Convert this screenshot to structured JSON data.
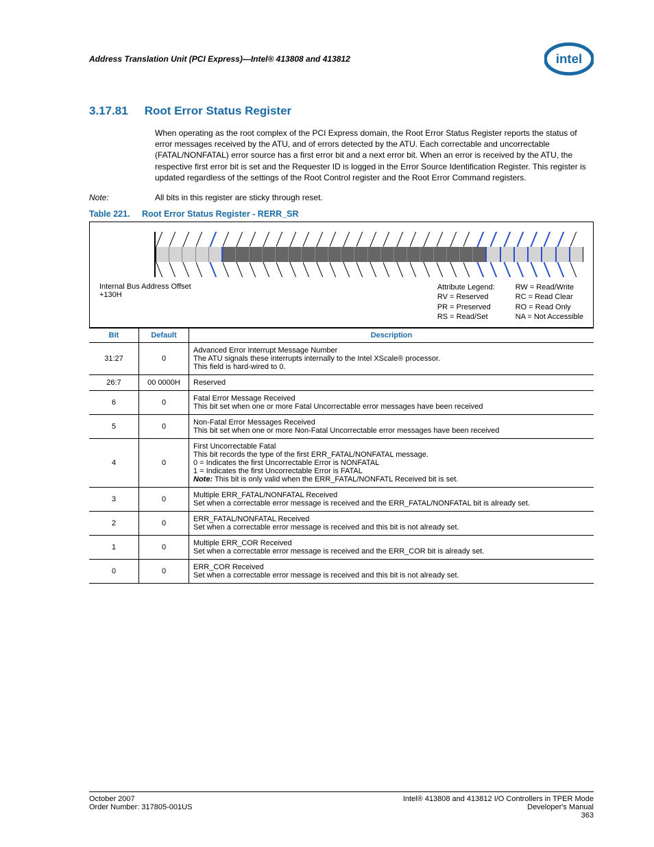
{
  "header": {
    "title": "Address Translation Unit (PCI Express)—Intel® 413808 and 413812"
  },
  "section": {
    "number": "3.17.81",
    "title": "Root Error Status Register",
    "paragraph": "When operating as the root complex of the PCI Express domain, the Root Error Status Register reports the status of error messages received by the ATU, and of errors detected by the ATU. Each correctable and uncorrectable (FATAL/NONFATAL) error source has a first error bit and a next error bit. When an error is received by the ATU, the respective first error bit is set and the Requester ID is logged in the Error Source Identification Register. This register is updated regardless of the settings of the Root Control register and the Root Error Command registers.",
    "note_label": "Note:",
    "note_text": "All bits in this register are sticky through reset."
  },
  "table_caption": {
    "number": "Table 221.",
    "title": "Root Error Status Register - RERR_SR"
  },
  "diagram": {
    "offset_label": "Internal Bus Address Offset",
    "offset_value": "+130H",
    "legend_title": "Attribute Legend:",
    "legend_left": [
      "RV = Reserved",
      "PR = Preserved",
      "RS = Read/Set"
    ],
    "legend_right": [
      "RW = Read/Write",
      "RC = Read Clear",
      "RO = Read Only",
      "NA = Not Accessible"
    ]
  },
  "table": {
    "headers": {
      "bit": "Bit",
      "default": "Default",
      "description": "Description"
    },
    "rows": [
      {
        "bit": "31:27",
        "default": "0",
        "desc": "Advanced Error Interrupt Message Number\nThe ATU signals these interrupts internally to the Intel XScale® processor.\nThis field is hard-wired to 0."
      },
      {
        "bit": "26:7",
        "default": "00 0000H",
        "desc": "Reserved"
      },
      {
        "bit": "6",
        "default": "0",
        "desc": "Fatal Error Message Received\nThis bit set when one or more Fatal Uncorrectable error messages have been received"
      },
      {
        "bit": "5",
        "default": "0",
        "desc": "Non-Fatal Error Messages Received\nThis bit set when one or more Non-Fatal Uncorrectable error messages have been received"
      },
      {
        "bit": "4",
        "default": "0",
        "desc": "First Uncorrectable Fatal\nThis bit records the type of the first ERR_FATAL/NONFATAL message.\n0 =  Indicates the first Uncorrectable Error is NONFATAL\n1 =  Indicates the first Uncorrectable Error is FATAL\nNote:   This bit is only valid when the ERR_FATAL/NONFATL Received bit is set."
      },
      {
        "bit": "3",
        "default": "0",
        "desc": "Multiple ERR_FATAL/NONFATAL Received\nSet when a correctable error message is received and the ERR_FATAL/NONFATAL bit is already set."
      },
      {
        "bit": "2",
        "default": "0",
        "desc": "ERR_FATAL/NONFATAL Received\nSet when a correctable error message is received and this bit is not already set."
      },
      {
        "bit": "1",
        "default": "0",
        "desc": "Multiple ERR_COR Received\nSet when a correctable error message is received and the ERR_COR bit is already set."
      },
      {
        "bit": "0",
        "default": "0",
        "desc": "ERR_COR Received\nSet when a correctable error message is received and this bit is not already set."
      }
    ]
  },
  "footer": {
    "left_line1": "October 2007",
    "left_line2": "Order Number: 317805-001US",
    "right_line1": "Intel® 413808 and 413812 I/O Controllers in TPER Mode",
    "right_line2": "Developer's Manual",
    "right_line3": "363"
  }
}
